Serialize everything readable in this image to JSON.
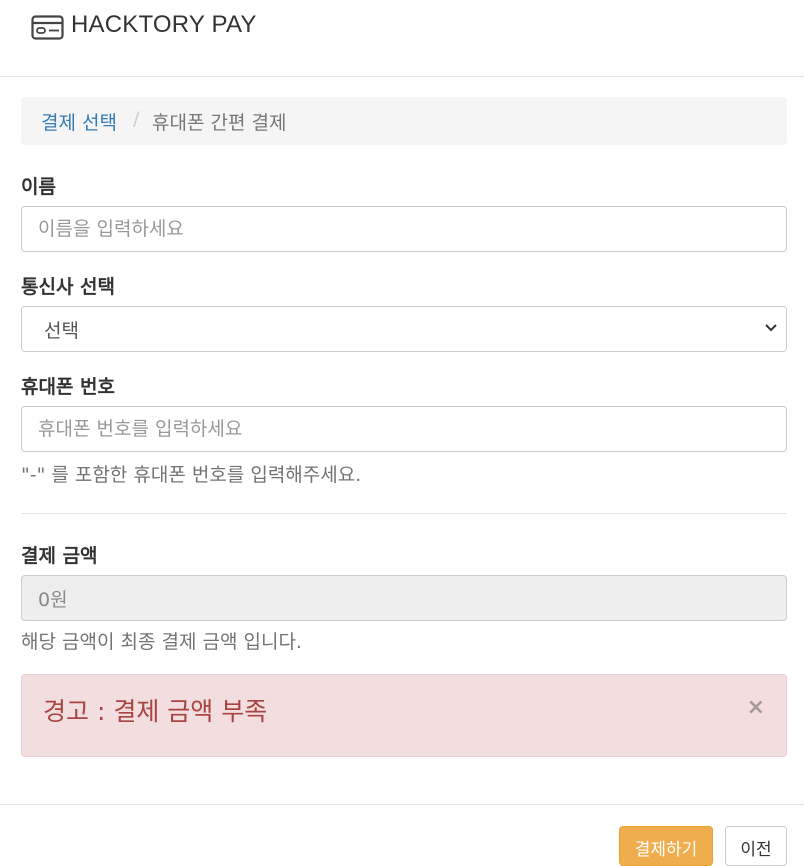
{
  "header": {
    "brand": "HACKTORY PAY"
  },
  "breadcrumb": {
    "link": "결제 선택",
    "separator": "/",
    "active": "휴대폰 간편 결제"
  },
  "form": {
    "name_label": "이름",
    "name_placeholder": "이름을 입력하세요",
    "carrier_label": "통신사 선택",
    "carrier_value": "선택",
    "phone_label": "휴대폰 번호",
    "phone_placeholder": "휴대폰 번호를 입력하세요",
    "phone_help": "\"-\" 를 포함한 휴대폰 번호를 입력해주세요.",
    "amount_label": "결제 금액",
    "amount_value": "0원",
    "amount_help": "해당 금액이 최종 결제 금액 입니다."
  },
  "alert": {
    "message": "경고 : 결제 금액 부족",
    "close": "×"
  },
  "footer": {
    "pay_button": "결제하기",
    "prev_button": "이전"
  },
  "colors": {
    "link": "#337ab7",
    "alert_text": "#a94442",
    "alert_bg": "#f2dede",
    "pay_button": "#f0ad4e"
  },
  "icons": {
    "logo": "credit-card-icon",
    "select_arrow": "chevron-down-icon"
  }
}
